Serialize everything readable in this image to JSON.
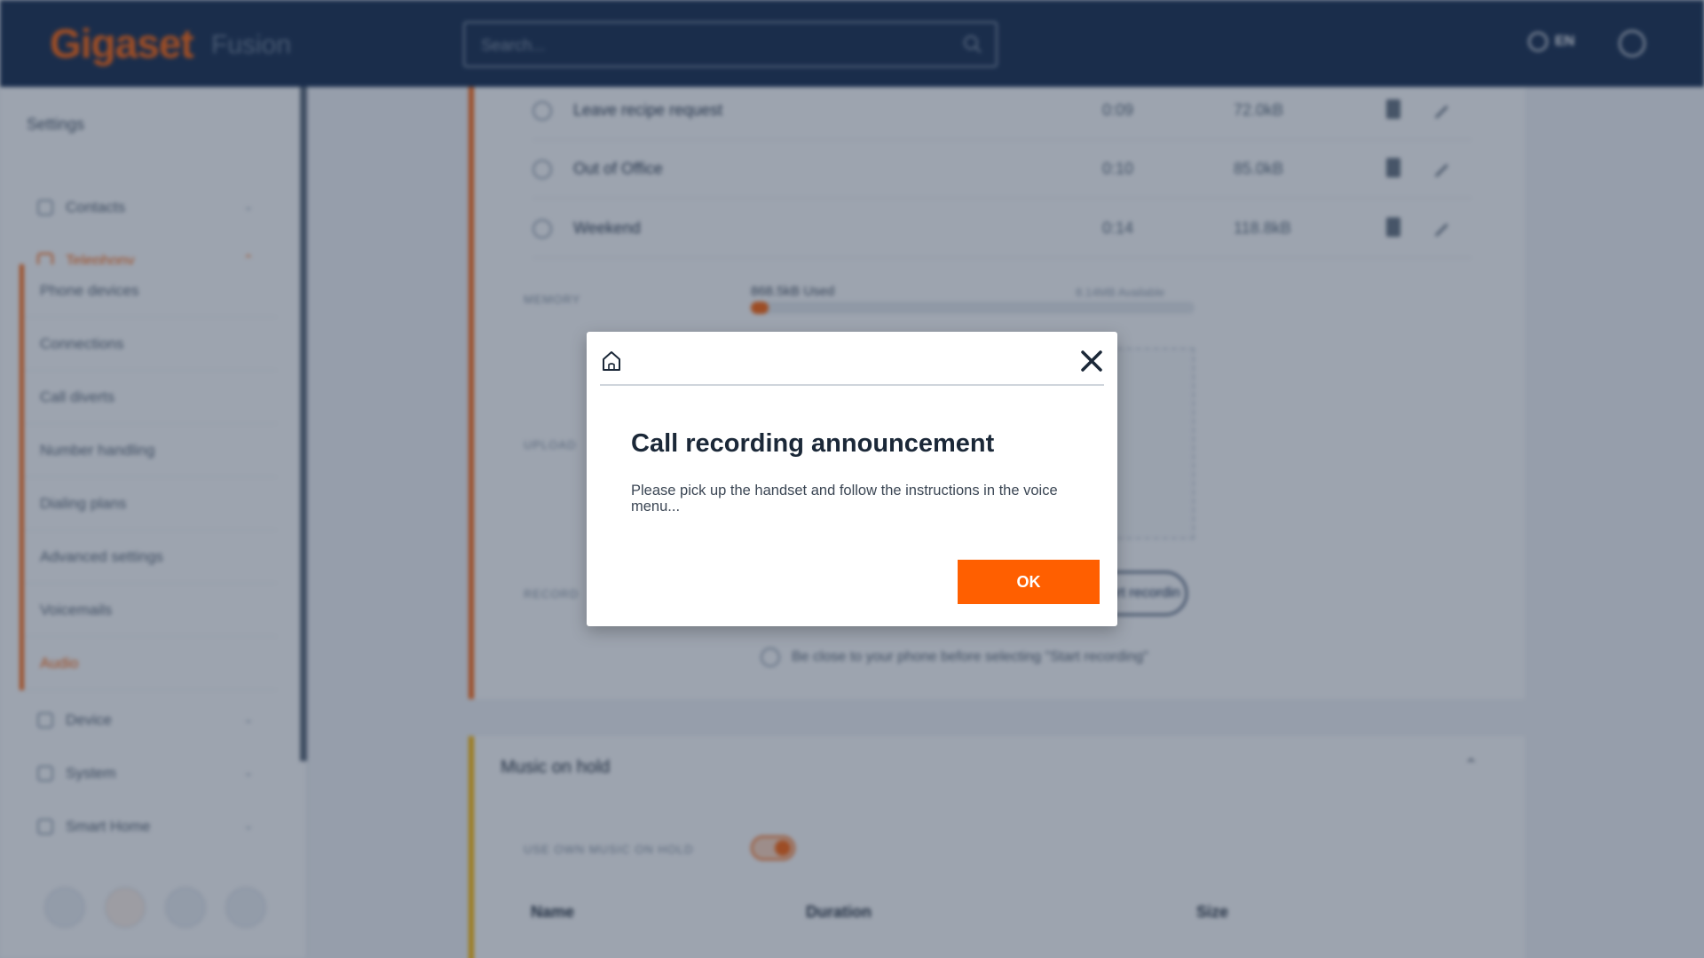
{
  "header": {
    "logo": "Gigaset",
    "logo_sub": "Fusion",
    "search_placeholder": "Search...",
    "language": "EN"
  },
  "sidebar": {
    "title": "Settings",
    "groups": [
      {
        "label": "Contacts"
      },
      {
        "label": "Telephony",
        "active": true
      },
      {
        "label": "Device"
      },
      {
        "label": "System"
      },
      {
        "label": "Smart Home"
      }
    ],
    "telephony_items": [
      {
        "label": "Phone devices"
      },
      {
        "label": "Connections"
      },
      {
        "label": "Call diverts"
      },
      {
        "label": "Number handling"
      },
      {
        "label": "Dialing plans"
      },
      {
        "label": "Advanced settings"
      },
      {
        "label": "Voicemails"
      },
      {
        "label": "Audio",
        "active": true
      }
    ]
  },
  "announcements": [
    {
      "name": "Leave recipe request",
      "duration": "0:09",
      "size": "72.0kB"
    },
    {
      "name": "Out of Office",
      "duration": "0:10",
      "size": "85.0kB"
    },
    {
      "name": "Weekend",
      "duration": "0:14",
      "size": "118.8kB"
    }
  ],
  "memory": {
    "label": "MEMORY",
    "used": "868.5kB Used",
    "available": "8.14MB Available",
    "used_fraction": 0.04
  },
  "upload_label": "UPLOAD",
  "record_row_label": "RECORD",
  "record_button": "Start recording",
  "hint": "Be close to your phone before selecting \"Start recording\"",
  "music_on_hold": {
    "title": "Music on hold",
    "toggle_label": "USE OWN MUSIC ON HOLD",
    "columns": [
      "Name",
      "Duration",
      "Size"
    ]
  },
  "modal": {
    "title": "Call recording announcement",
    "text": "Please pick up the handset and follow the instructions in the voice menu...",
    "ok": "OK"
  },
  "colors": {
    "accent": "#ff5f00",
    "header": "#1e3354",
    "title": "#1b2838"
  }
}
